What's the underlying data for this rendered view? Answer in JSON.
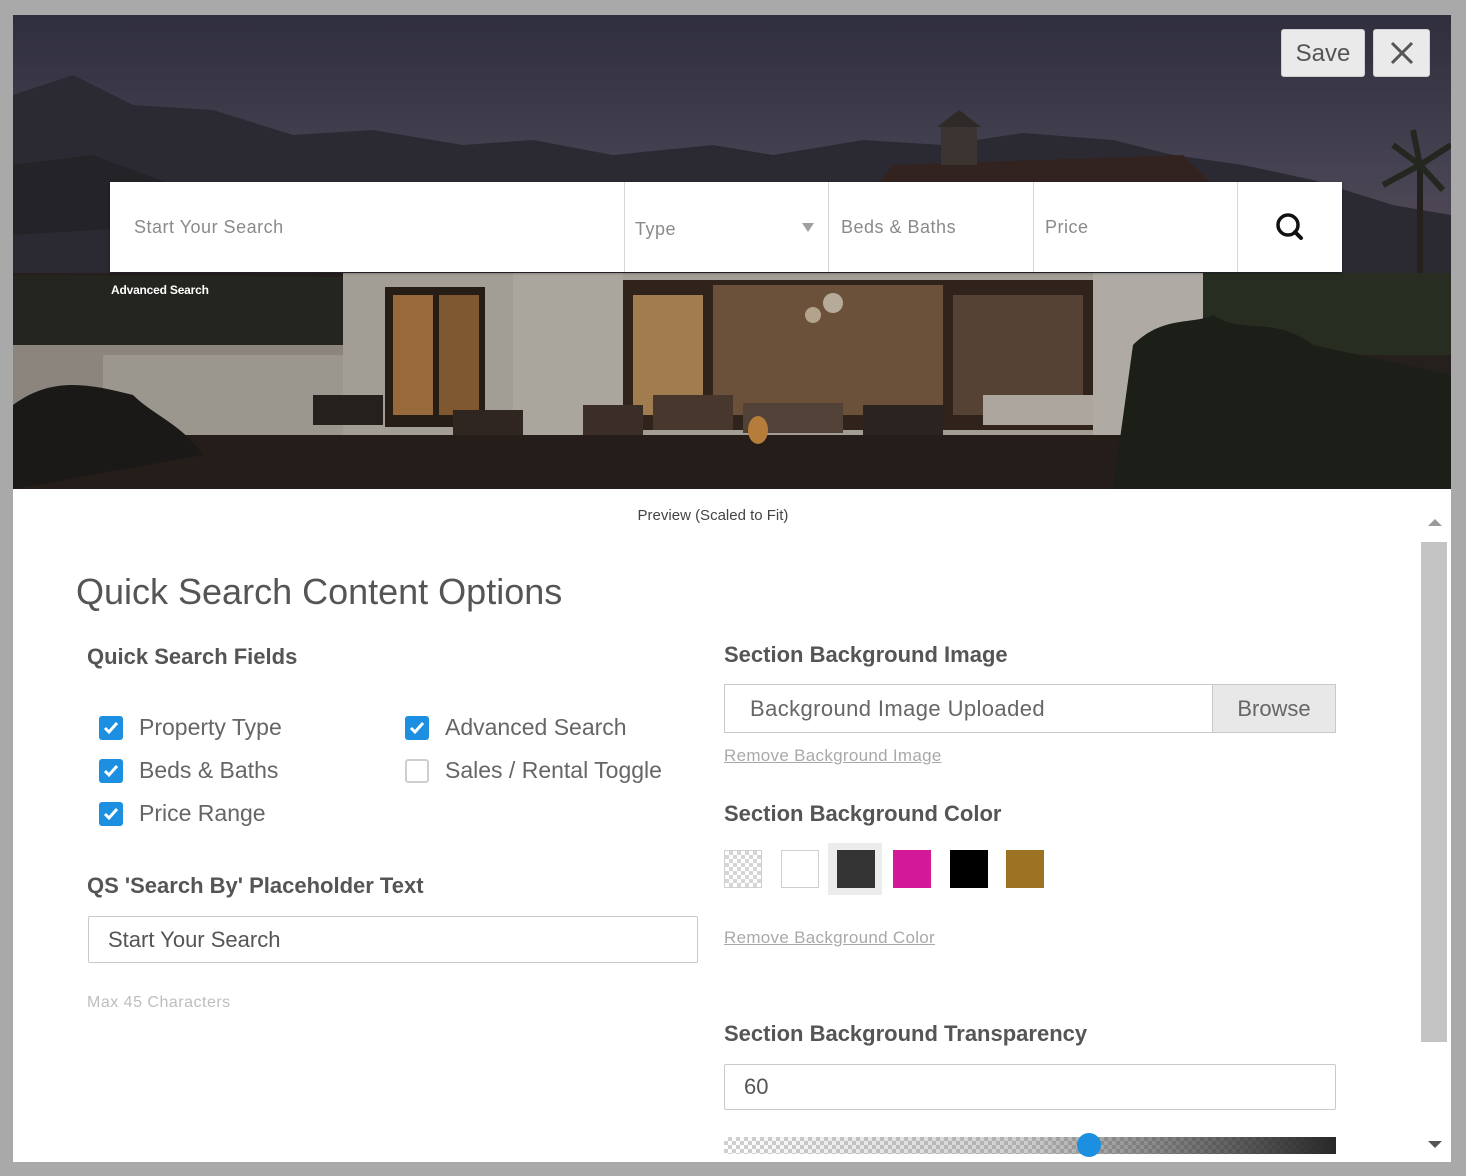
{
  "toolbar": {
    "save_label": "Save",
    "close_icon": "close-icon"
  },
  "preview": {
    "search_placeholder": "Start Your Search",
    "type_label": "Type",
    "beds_label": "Beds & Baths",
    "price_label": "Price",
    "search_icon": "search-icon",
    "advanced_link": "Advanced Search",
    "caption": "Preview (Scaled to Fit)"
  },
  "panel": {
    "title": "Quick Search Content Options",
    "fields_heading": "Quick Search Fields",
    "fields": [
      {
        "label": "Property Type",
        "checked": true
      },
      {
        "label": "Beds & Baths",
        "checked": true
      },
      {
        "label": "Price Range",
        "checked": true
      },
      {
        "label": "Advanced Search",
        "checked": true
      },
      {
        "label": "Sales / Rental Toggle",
        "checked": false
      }
    ],
    "placeholder_heading": "QS 'Search By' Placeholder Text",
    "placeholder_value": "Start Your Search",
    "placeholder_hint": "Max 45 Characters",
    "bg_image_heading": "Section Background Image",
    "bg_image_value": "Background Image Uploaded",
    "browse_label": "Browse",
    "remove_image_link": "Remove Background Image",
    "bg_color_heading": "Section Background Color",
    "swatches": [
      {
        "name": "transparent",
        "color": "transparent"
      },
      {
        "name": "white",
        "color": "#ffffff"
      },
      {
        "name": "dark-gray",
        "color": "#333333",
        "selected": true
      },
      {
        "name": "magenta",
        "color": "#d4189a"
      },
      {
        "name": "black",
        "color": "#000000"
      },
      {
        "name": "gold",
        "color": "#9c7223"
      }
    ],
    "remove_color_link": "Remove Background Color",
    "transparency_heading": "Section Background Transparency",
    "transparency_value": "60",
    "transparency_level_percent": 60
  },
  "colors": {
    "accent": "#1c8fe0"
  }
}
